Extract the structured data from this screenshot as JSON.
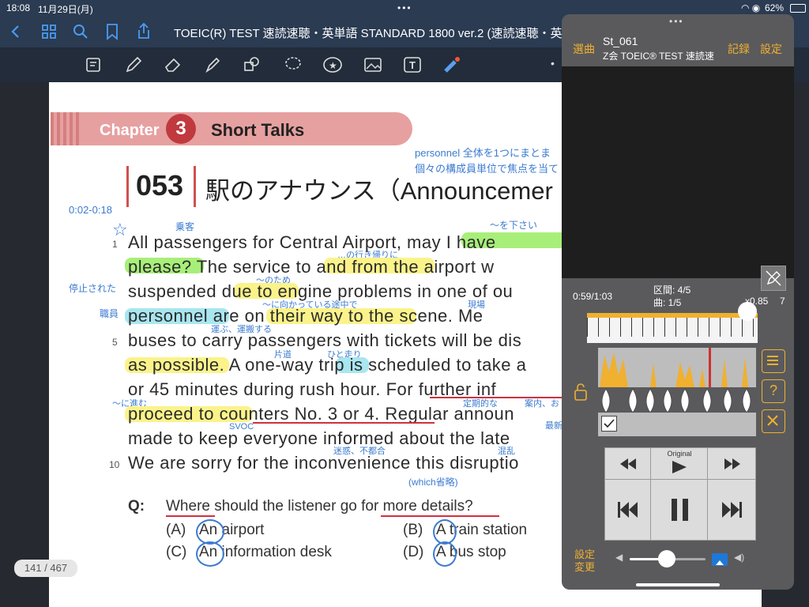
{
  "status": {
    "time": "18:08",
    "date": "11月29日(月)",
    "battery": "62%"
  },
  "topbar": {
    "title": "TOEIC(R) TEST 速読速聴・英単語 STANDARD 1800 ver.2 (速読速聴・英"
  },
  "page": {
    "chapter_label": "Chapter",
    "chapter_num": "3",
    "chapter_title": "Short Talks",
    "item_num": "053",
    "item_title": "駅のアナウンス（Announcemer",
    "timestamp": "0:02-0:18",
    "side_notes": [
      "停止された",
      "職員"
    ],
    "top_notes": [
      "personnel 全体を1つにまとま",
      "個々の構成員単位で焦点を当て"
    ],
    "lines": [
      {
        "num": "1",
        "text": "All passengers for Central Airport, may I have"
      },
      {
        "num": "",
        "text": "please?  The service to and from the airport w"
      },
      {
        "num": "",
        "text": "suspended due to engine problems in one of ou"
      },
      {
        "num": "",
        "text": "personnel are on their way to the scene.  Me"
      },
      {
        "num": "5",
        "text": "buses to carry passengers with tickets will be dis"
      },
      {
        "num": "",
        "text": "as possible.  A one-way trip is scheduled to take a"
      },
      {
        "num": "",
        "text": "or 45 minutes during rush hour.  For further inf"
      },
      {
        "num": "",
        "text": "proceed to counters No. 3 or 4.  Regular announ"
      },
      {
        "num": "",
        "text": "made to keep everyone informed about the late"
      },
      {
        "num": "10",
        "text": "We are sorry for the inconvenience this disruptio"
      }
    ],
    "annotations": [
      "乗客",
      "〜を下さい",
      "…の行き帰りに",
      "〜のため",
      "〜に向かっている途中で",
      "現場",
      "運ぶ、運搬する",
      "片道",
      "ひと走り",
      "定期的な",
      "案内、お",
      "最新",
      "〜に進む",
      "SVOC",
      "迷惑、不都合",
      "混乱",
      "(which省略)"
    ],
    "question": {
      "label": "Q:",
      "text": "Where should the listener go for more details?"
    },
    "choices": [
      {
        "key": "(A)",
        "text": "An airport"
      },
      {
        "key": "(B)",
        "text": "A train station"
      },
      {
        "key": "(C)",
        "text": "An information desk"
      },
      {
        "key": "(D)",
        "text": "A bus stop"
      }
    ],
    "page_counter": "141 / 467"
  },
  "player": {
    "select_label": "選曲",
    "track_name": "St_061",
    "track_sub": "Z会 TOEIC® TEST 速読速",
    "record_label": "記録",
    "settings_label": "設定",
    "time": "0:59/1:03",
    "section": "区間: 4/5",
    "song": "曲: 1/5",
    "speed": "x0.85",
    "speed_step": "7",
    "original_label": "Original",
    "settings_change": "設定\n変更",
    "colors": {
      "accent": "#f0b030",
      "panel": "#5a5a5c"
    }
  }
}
